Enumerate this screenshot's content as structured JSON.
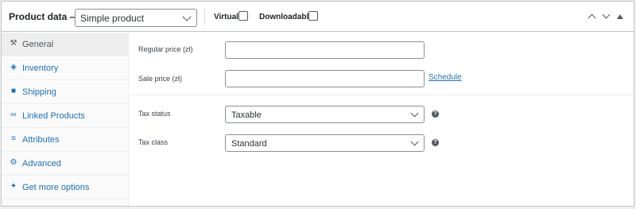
{
  "header": {
    "title": "Product data —",
    "product_type": "Simple product",
    "virtual_label": "Virtual:",
    "downloadable_label": "Downloadable:"
  },
  "sidebar": {
    "items": [
      {
        "label": "General",
        "icon": "wrench-icon",
        "glyph": "⚒"
      },
      {
        "label": "Inventory",
        "icon": "tag-icon",
        "glyph": "◈"
      },
      {
        "label": "Shipping",
        "icon": "truck-icon",
        "glyph": "■"
      },
      {
        "label": "Linked Products",
        "icon": "link-icon",
        "glyph": "∞"
      },
      {
        "label": "Attributes",
        "icon": "list-icon",
        "glyph": "≡"
      },
      {
        "label": "Advanced",
        "icon": "gear-icon",
        "glyph": "⚙"
      },
      {
        "label": "Get more options",
        "icon": "plugin-icon",
        "glyph": "✦"
      }
    ]
  },
  "general": {
    "regular_price_label": "Regular price (zł)",
    "regular_price_value": "",
    "sale_price_label": "Sale price (zł)",
    "sale_price_value": "",
    "schedule_link": "Schedule",
    "tax_status_label": "Tax status",
    "tax_status_value": "Taxable",
    "tax_class_label": "Tax class",
    "tax_class_value": "Standard",
    "help_glyph": "?"
  },
  "colors": {
    "link": "#2271b1",
    "border": "#c3c4c7",
    "sidebar_bg": "#fafafa",
    "active_tab_bg": "#eeeeee"
  }
}
